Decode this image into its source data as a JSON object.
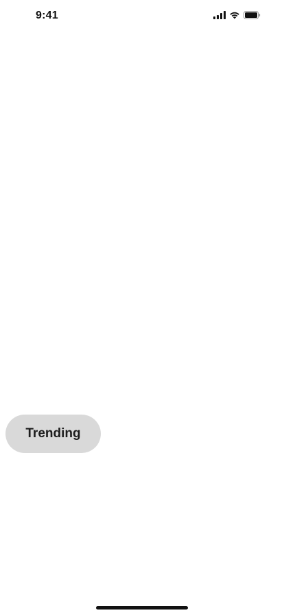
{
  "status_bar": {
    "time": "9:41",
    "icons": [
      "cellular-signal-icon",
      "wifi-icon",
      "battery-icon"
    ]
  },
  "main": {
    "chip_label": "Trending"
  },
  "colors": {
    "background": "#ffffff",
    "chip_background": "#d9d9d9",
    "text": "#1c1c1c",
    "home_indicator": "#111111"
  }
}
